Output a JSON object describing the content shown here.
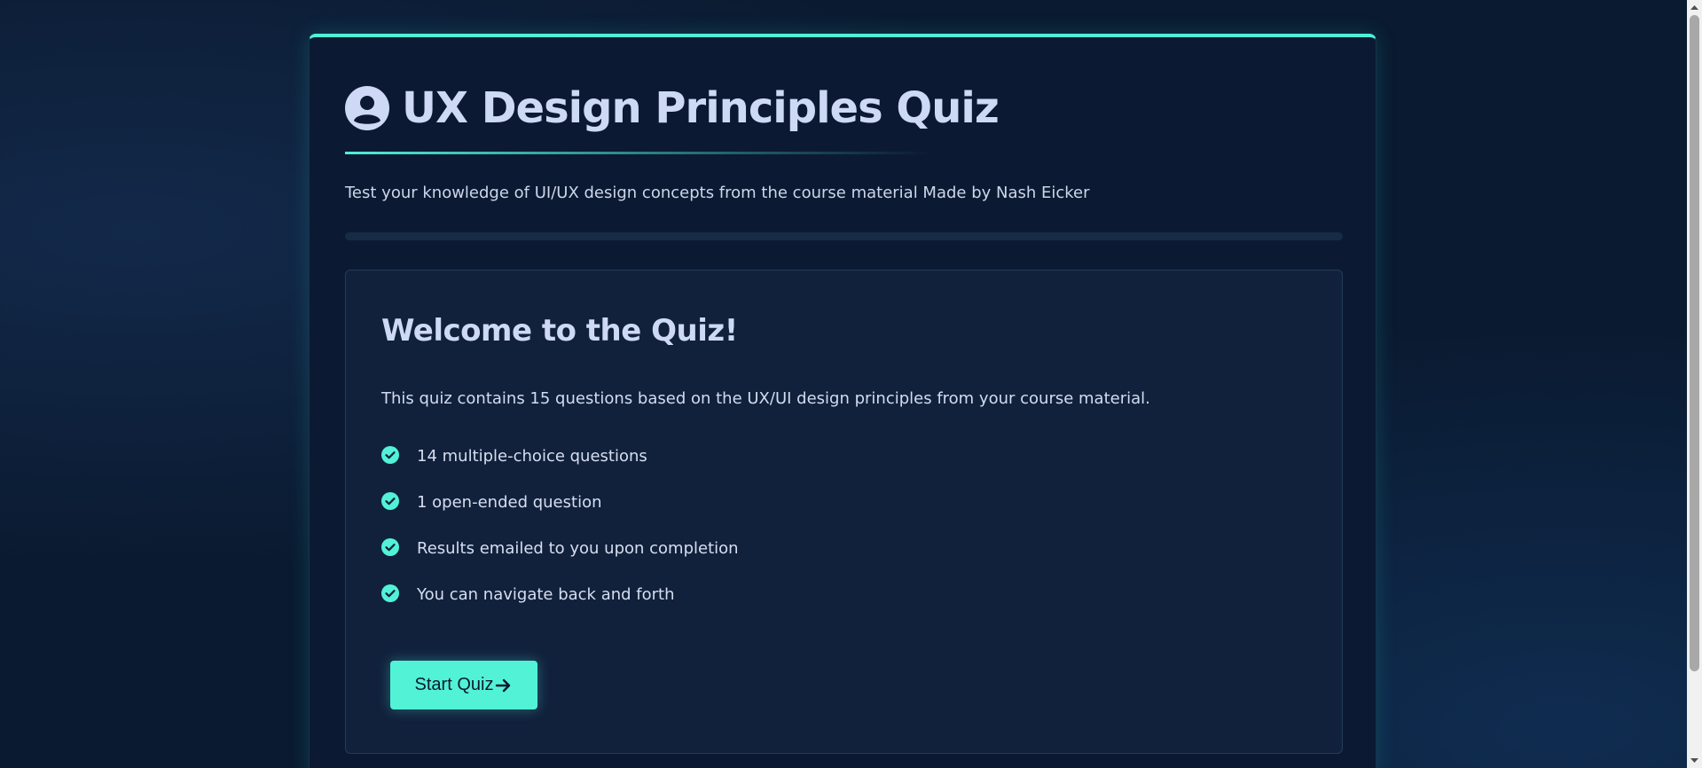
{
  "quiz": {
    "title": "UX Design Principles Quiz",
    "subtitle": "Test your knowledge of UI/UX design concepts from the course material Made by Nash Eicker",
    "progress_percent": 0
  },
  "welcome": {
    "title": "Welcome to the Quiz!",
    "description": "This quiz contains 15 questions based on the UX/UI design principles from your course material.",
    "features": [
      {
        "text": "14 multiple-choice questions",
        "icon": "check-circle-icon"
      },
      {
        "text": "1 open-ended question",
        "icon": "check-circle-icon"
      },
      {
        "text": "Results emailed to you upon completion",
        "icon": "check-circle-icon"
      },
      {
        "text": "You can navigate back and forth",
        "icon": "check-circle-icon"
      }
    ],
    "start_button_label": "Start Quiz"
  },
  "icons": {
    "header": "user-circle-icon",
    "start_button": "arrow-right-icon"
  },
  "colors": {
    "accent": "#4ff0d8",
    "background": "#0a1a30",
    "card": "#11213c",
    "text": "#cdd9f5"
  }
}
